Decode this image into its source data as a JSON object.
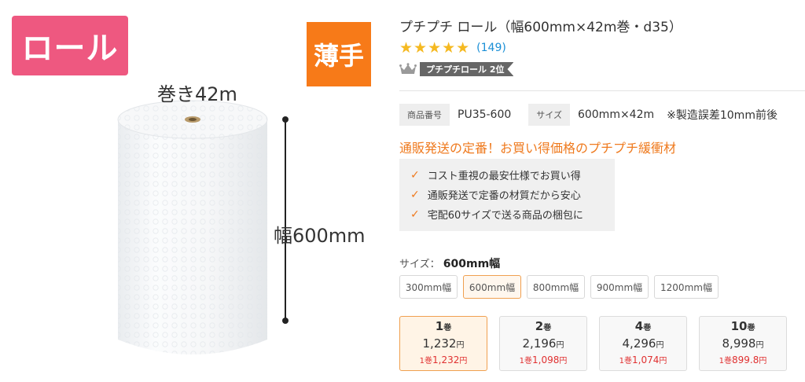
{
  "image": {
    "badge_roll": "ロール",
    "badge_thin": "薄手",
    "length_label": "巻き42m",
    "width_label": "幅600mm",
    "colors": {
      "roll_badge": "#ee5880",
      "thin_badge": "#f77a18"
    }
  },
  "product": {
    "title": "プチプチ ロール（幅600mm×42m巻・d35）",
    "rating": {
      "stars": "★★★★★",
      "count": "(149)",
      "value": 5
    },
    "rank": {
      "icon": "crown-icon",
      "label": "プチプチロール 2位"
    },
    "specs": {
      "code_key": "商品番号",
      "code_value": "PU35-600",
      "size_key": "サイズ",
      "size_value": "600mm×42m",
      "size_note": "※製造誤差10mm前後"
    },
    "catch_copy": "通販発送の定番！お買い得価格のプチプチ緩衝材",
    "features": [
      "コスト重視の最安仕様でお買い得",
      "通販発送で定番の材質だから安心",
      "宅配60サイズで送る商品の梱包に"
    ],
    "size_selector": {
      "label": "サイズ：",
      "selected": "600mm幅",
      "options": [
        "300mm幅",
        "600mm幅",
        "800mm幅",
        "900mm幅",
        "1200mm幅"
      ]
    },
    "quantity_options": [
      {
        "num": "1",
        "unit": "巻",
        "price": "1,232",
        "yen": "円",
        "per_prefix": "1巻",
        "per_price": "1,232",
        "selected": true
      },
      {
        "num": "2",
        "unit": "巻",
        "price": "2,196",
        "yen": "円",
        "per_prefix": "1巻",
        "per_price": "1,098",
        "selected": false
      },
      {
        "num": "4",
        "unit": "巻",
        "price": "4,296",
        "yen": "円",
        "per_prefix": "1巻",
        "per_price": "1,074",
        "selected": false
      },
      {
        "num": "10",
        "unit": "巻",
        "price": "8,998",
        "yen": "円",
        "per_prefix": "1巻",
        "per_price": "899.8",
        "selected": false
      }
    ],
    "colors": {
      "accent": "#ef7a1e",
      "star": "#f5b921",
      "link": "#1a8fd6",
      "price_red": "#e03030"
    }
  }
}
